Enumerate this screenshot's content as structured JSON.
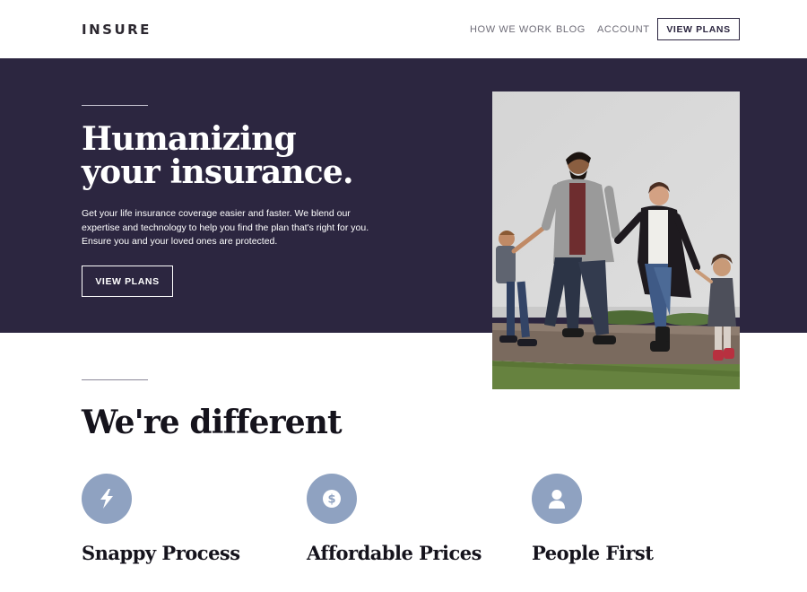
{
  "header": {
    "logo": "INSURE",
    "nav": [
      "HOW WE WORK",
      "BLOG",
      "ACCOUNT"
    ],
    "cta": "VIEW PLANS"
  },
  "hero": {
    "title_line1": "Humanizing",
    "title_line2": "your insurance.",
    "text": "Get your life insurance coverage easier and faster. We blend our expertise and technology to help you find the plan that's right for you. Ensure you and your loved ones are protected.",
    "cta": "VIEW PLANS",
    "image_alt": "family-walking-photo"
  },
  "different": {
    "title": "We're different",
    "features": [
      {
        "icon": "lightning-icon",
        "title": "Snappy Process"
      },
      {
        "icon": "dollar-icon",
        "title": "Affordable Prices"
      },
      {
        "icon": "person-icon",
        "title": "People First"
      }
    ]
  },
  "colors": {
    "primary": "#2c2640",
    "icon_bg": "#8fa2c1"
  }
}
